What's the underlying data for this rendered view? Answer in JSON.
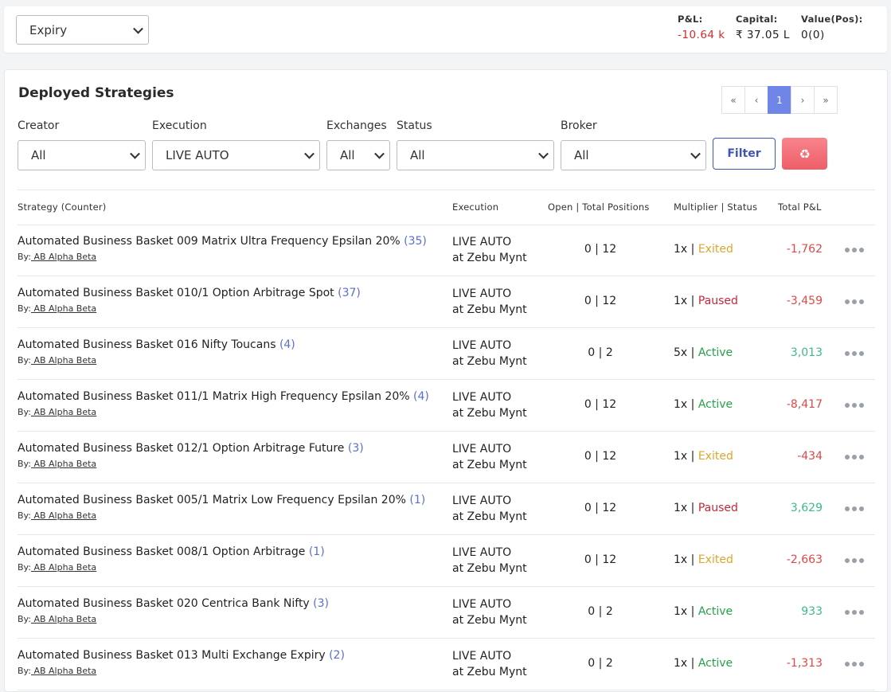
{
  "top": {
    "expiry_select": "Expiry",
    "pnl_label": "P&L:",
    "pnl_value": "-10.64 k",
    "capital_label": "Capital:",
    "capital_value": "₹ 37.05 L",
    "value_label": "Value(Pos):",
    "value_value": "0(0)"
  },
  "card": {
    "title": "Deployed Strategies",
    "pager": [
      "«",
      "‹",
      "1",
      "›",
      "»"
    ],
    "filters": {
      "creator_label": "Creator",
      "creator_value": "All",
      "execution_label": "Execution",
      "execution_value": "LIVE AUTO",
      "exchanges_label": "Exchanges",
      "exchanges_value": "All",
      "status_label": "Status",
      "status_value": "All",
      "broker_label": "Broker",
      "broker_value": "All",
      "filter_button": "Filter",
      "reset_icon": "♻"
    },
    "columns": {
      "strategy": "Strategy (Counter)",
      "execution": "Execution",
      "positions": "Open | Total Positions",
      "multiplier": "Multiplier | Status",
      "pnl": "Total P&L"
    },
    "rows": [
      {
        "name": "Automated Business Basket 009 Matrix Ultra Frequency Epsilan 20%",
        "counter": "(35)",
        "by": "By:",
        "creator": " AB Alpha Beta",
        "exec1": "LIVE AUTO",
        "exec2": "at Zebu Mynt",
        "open": "0",
        "total": "12",
        "mult": "1x",
        "status": "Exited",
        "pnl": "-1,762"
      },
      {
        "name": "Automated Business Basket 010/1 Option Arbitrage Spot",
        "counter": "(37)",
        "by": "By:",
        "creator": " AB Alpha Beta",
        "exec1": "LIVE AUTO",
        "exec2": "at Zebu Mynt",
        "open": "0",
        "total": "12",
        "mult": "1x",
        "status": "Paused",
        "pnl": "-3,459"
      },
      {
        "name": "Automated Business Basket 016 Nifty Toucans",
        "counter": "(4)",
        "by": "By:",
        "creator": " AB Alpha Beta",
        "exec1": "LIVE AUTO",
        "exec2": "at Zebu Mynt",
        "open": "0",
        "total": "2",
        "mult": "5x",
        "status": "Active",
        "pnl": "3,013"
      },
      {
        "name": "Automated Business Basket 011/1 Matrix High Frequency Epsilan 20%",
        "counter": "(4)",
        "by": "By:",
        "creator": " AB Alpha Beta",
        "exec1": "LIVE AUTO",
        "exec2": "at Zebu Mynt",
        "open": "0",
        "total": "12",
        "mult": "1x",
        "status": "Active",
        "pnl": "-8,417"
      },
      {
        "name": "Automated Business Basket 012/1 Option Arbitrage Future",
        "counter": "(3)",
        "by": "By:",
        "creator": " AB Alpha Beta",
        "exec1": "LIVE AUTO",
        "exec2": "at Zebu Mynt",
        "open": "0",
        "total": "12",
        "mult": "1x",
        "status": "Exited",
        "pnl": "-434"
      },
      {
        "name": "Automated Business Basket 005/1 Matrix Low Frequency Epsilan 20%",
        "counter": "(1)",
        "by": "By:",
        "creator": " AB Alpha Beta",
        "exec1": "LIVE AUTO",
        "exec2": "at Zebu Mynt",
        "open": "0",
        "total": "12",
        "mult": "1x",
        "status": "Paused",
        "pnl": "3,629"
      },
      {
        "name": "Automated Business Basket 008/1 Option Arbitrage",
        "counter": "(1)",
        "by": "By:",
        "creator": " AB Alpha Beta",
        "exec1": "LIVE AUTO",
        "exec2": "at Zebu Mynt",
        "open": "0",
        "total": "12",
        "mult": "1x",
        "status": "Exited",
        "pnl": "-2,663"
      },
      {
        "name": "Automated Business Basket 020 Centrica Bank Nifty",
        "counter": "(3)",
        "by": "By:",
        "creator": " AB Alpha Beta",
        "exec1": "LIVE AUTO",
        "exec2": "at Zebu Mynt",
        "open": "0",
        "total": "2",
        "mult": "1x",
        "status": "Active",
        "pnl": "933"
      },
      {
        "name": "Automated Business Basket 013 Multi Exchange Expiry",
        "counter": "(2)",
        "by": "By:",
        "creator": " AB Alpha Beta",
        "exec1": "LIVE AUTO",
        "exec2": "at Zebu Mynt",
        "open": "0",
        "total": "2",
        "mult": "1x",
        "status": "Active",
        "pnl": "-1,313"
      }
    ]
  }
}
